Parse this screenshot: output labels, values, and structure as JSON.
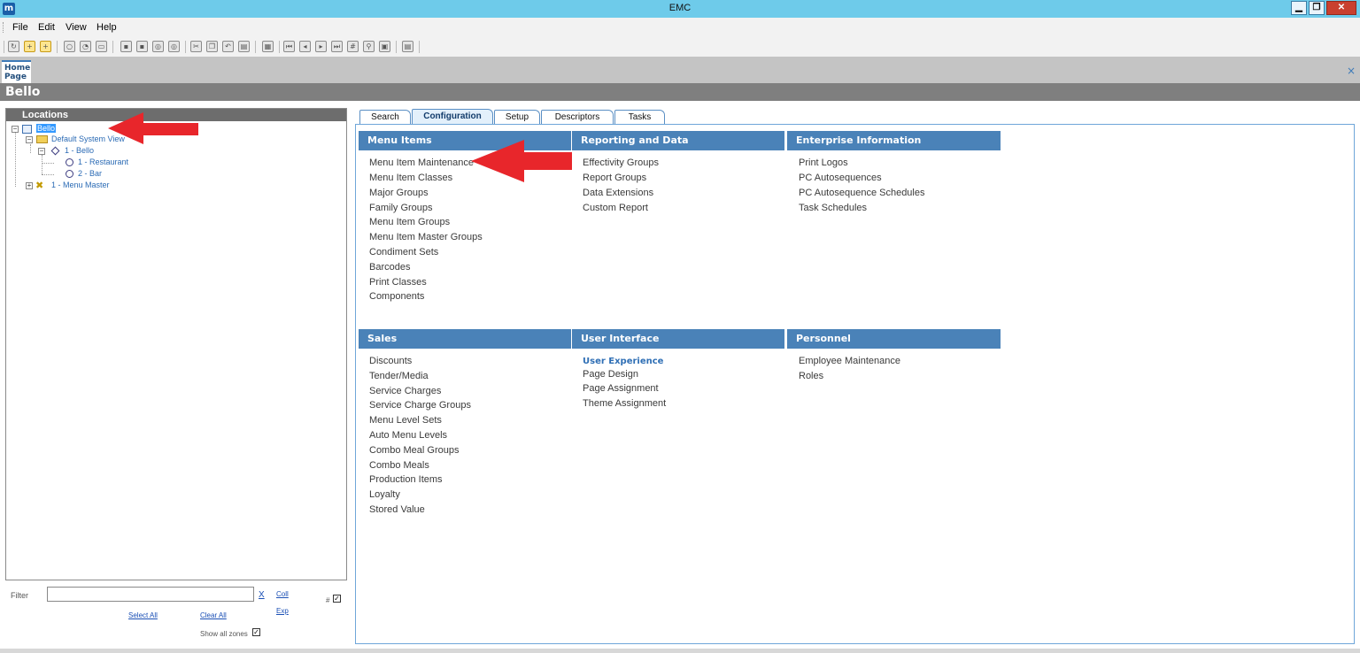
{
  "window": {
    "title": "EMC",
    "icon_glyph": "m",
    "controls": [
      "▁",
      "❐",
      "✕"
    ]
  },
  "menubar": {
    "items": [
      "File",
      "Edit",
      "View",
      "Help"
    ]
  },
  "doc_tabs": {
    "home_tab": "Home\nPage",
    "home_line1": "Home",
    "home_line2": "Page",
    "close_glyph": "×"
  },
  "page": {
    "title": "Bello"
  },
  "locations": {
    "header": "Locations",
    "tree": {
      "root": "Bello",
      "system_view": "Default System View",
      "property": "1 - Bello",
      "rvc1": "1 - Restaurant",
      "rvc2": "2 - Bar",
      "menu_master": "1 - Menu Master"
    }
  },
  "filter": {
    "label": "Filter",
    "value": "",
    "clear_label": "X",
    "collapse_label": "Coll",
    "expand_label": "Exp",
    "hash_label": "#",
    "select_all": "Select All",
    "clear_all": "Clear All",
    "show_all_zones": "Show all zones",
    "hash_checked": true,
    "show_all_zones_checked": true
  },
  "tabs": [
    {
      "label": "Search",
      "active": false
    },
    {
      "label": "Configuration",
      "active": true
    },
    {
      "label": "Setup",
      "active": false
    },
    {
      "label": "Descriptors",
      "active": false
    },
    {
      "label": "Tasks",
      "active": false
    }
  ],
  "sections": {
    "menu_items": {
      "title": "Menu Items",
      "items": [
        "Menu Item Maintenance",
        "Menu Item Classes",
        "Major Groups",
        "Family Groups",
        "Menu Item Groups",
        "Menu Item Master Groups",
        "Condiment Sets",
        "Barcodes",
        "Print Classes",
        "Components"
      ]
    },
    "reporting": {
      "title": "Reporting and Data",
      "items": [
        "Effectivity Groups",
        "Report Groups",
        "Data Extensions",
        "Custom Report"
      ]
    },
    "enterprise": {
      "title": "Enterprise Information",
      "items": [
        "Print Logos",
        "PC Autosequences",
        "PC Autosequence Schedules",
        "Task Schedules"
      ]
    },
    "sales": {
      "title": "Sales",
      "items": [
        "Discounts",
        "Tender/Media",
        "Service Charges",
        "Service Charge Groups",
        "Menu Level Sets",
        "Auto Menu Levels",
        "Combo Meal Groups",
        "Combo Meals",
        "Production Items",
        "Loyalty",
        "Stored Value"
      ]
    },
    "user_interface": {
      "title": "User Interface",
      "subheading": "User Experience",
      "items": [
        "Page Design",
        "Page Assignment",
        "Theme Assignment"
      ]
    },
    "personnel": {
      "title": "Personnel",
      "items": [
        "Employee Maintenance",
        "Roles"
      ]
    }
  },
  "colors": {
    "titlebar": "#6ecbea",
    "section_header": "#4a82b8",
    "annotation_arrow": "#e8262b",
    "page_title_bar": "#7f7f7f"
  }
}
